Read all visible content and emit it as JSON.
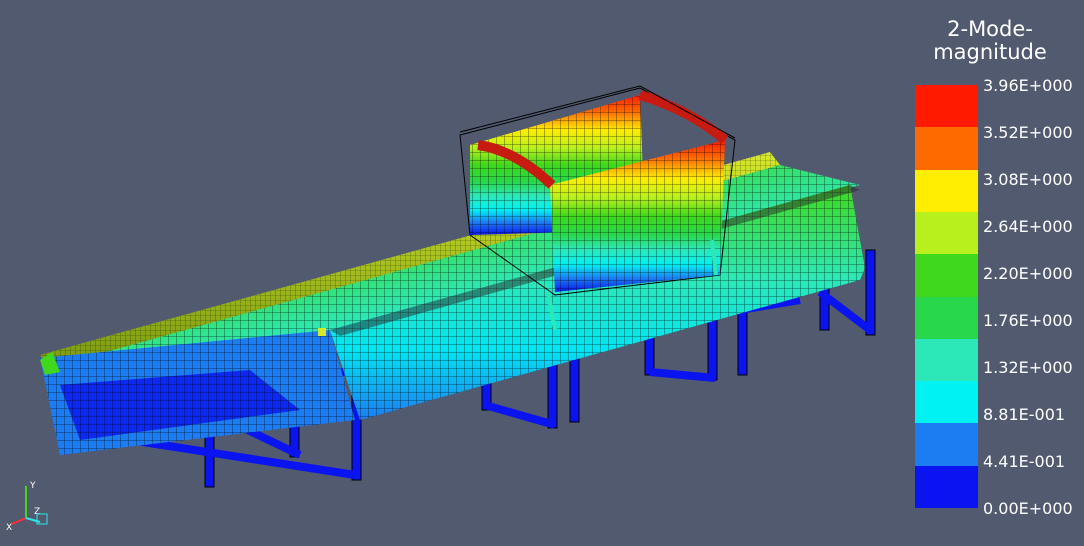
{
  "legend": {
    "title_line1": "2-Mode-",
    "title_line2": "magnitude",
    "labels": [
      "3.96E+000",
      "3.52E+000",
      "3.08E+000",
      "2.64E+000",
      "2.20E+000",
      "1.76E+000",
      "1.32E+000",
      "8.81E-001",
      "4.41E-001",
      "0.00E+000"
    ],
    "colors": [
      "#ff1a00",
      "#ff6a00",
      "#ffee00",
      "#b7f01c",
      "#3fd81c",
      "#28d84a",
      "#2ce8b8",
      "#00f2f2",
      "#1c7cf2",
      "#0a14f0"
    ]
  },
  "axes": {
    "x": "X",
    "y": "Y",
    "z": "Z"
  },
  "colors": {
    "background": "#525a70"
  }
}
